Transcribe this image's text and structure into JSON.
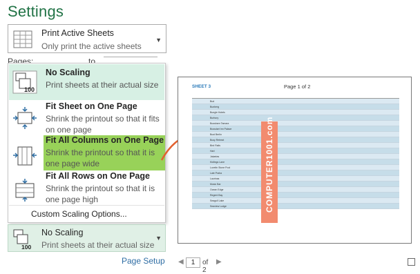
{
  "settings": {
    "title": "Settings"
  },
  "print_what": {
    "main": "Print Active Sheets",
    "sub": "Only print the active sheets",
    "icon": "print-sheets-icon"
  },
  "pages": {
    "label": "Pages:",
    "to": "to"
  },
  "scaling_menu": {
    "items": [
      {
        "title": "No Scaling",
        "desc": "Print sheets at their actual size",
        "icon": "no-scaling-icon"
      },
      {
        "title": "Fit Sheet on One Page",
        "desc": "Shrink the printout so that it fits on one page",
        "icon": "fit-sheet-icon"
      },
      {
        "title": "Fit All Columns on One Page",
        "desc": "Shrink the printout so that it is one page wide",
        "icon": "fit-columns-icon"
      },
      {
        "title": "Fit All Rows on One Page",
        "desc": "Shrink the printout so that it is one page high",
        "icon": "fit-rows-icon"
      }
    ],
    "custom": "Custom Scaling Options...",
    "highlight_color": "#92d050"
  },
  "scaling_current": {
    "title": "No Scaling",
    "desc": "Print sheets at their actual size"
  },
  "page_setup": "Page Setup",
  "preview": {
    "sheet_title": "SHEET 3",
    "page_label": "Page 1 of 2",
    "watermark": "COMPUTER1001.com",
    "watermark_color": "#f28b6f",
    "rows": [
      "Bud",
      "Bunberg",
      "Bungle Hotels",
      "Burbury",
      "Bussbarn Tamara",
      "Bussdart Inn Palace",
      "Bust Berlin",
      "Busy Retreat",
      "Bird Rails",
      "Hart",
      "Jakartas",
      "Kidlings Lane",
      "Lovelin Stone Pool",
      "Late Praha",
      "Laurinas",
      "Music Bar",
      "Ocean Edge",
      "Regent Bay",
      "Seagull Lake",
      "Seaview Lodge"
    ]
  },
  "navigator": {
    "page": "1",
    "of": "of 2"
  }
}
